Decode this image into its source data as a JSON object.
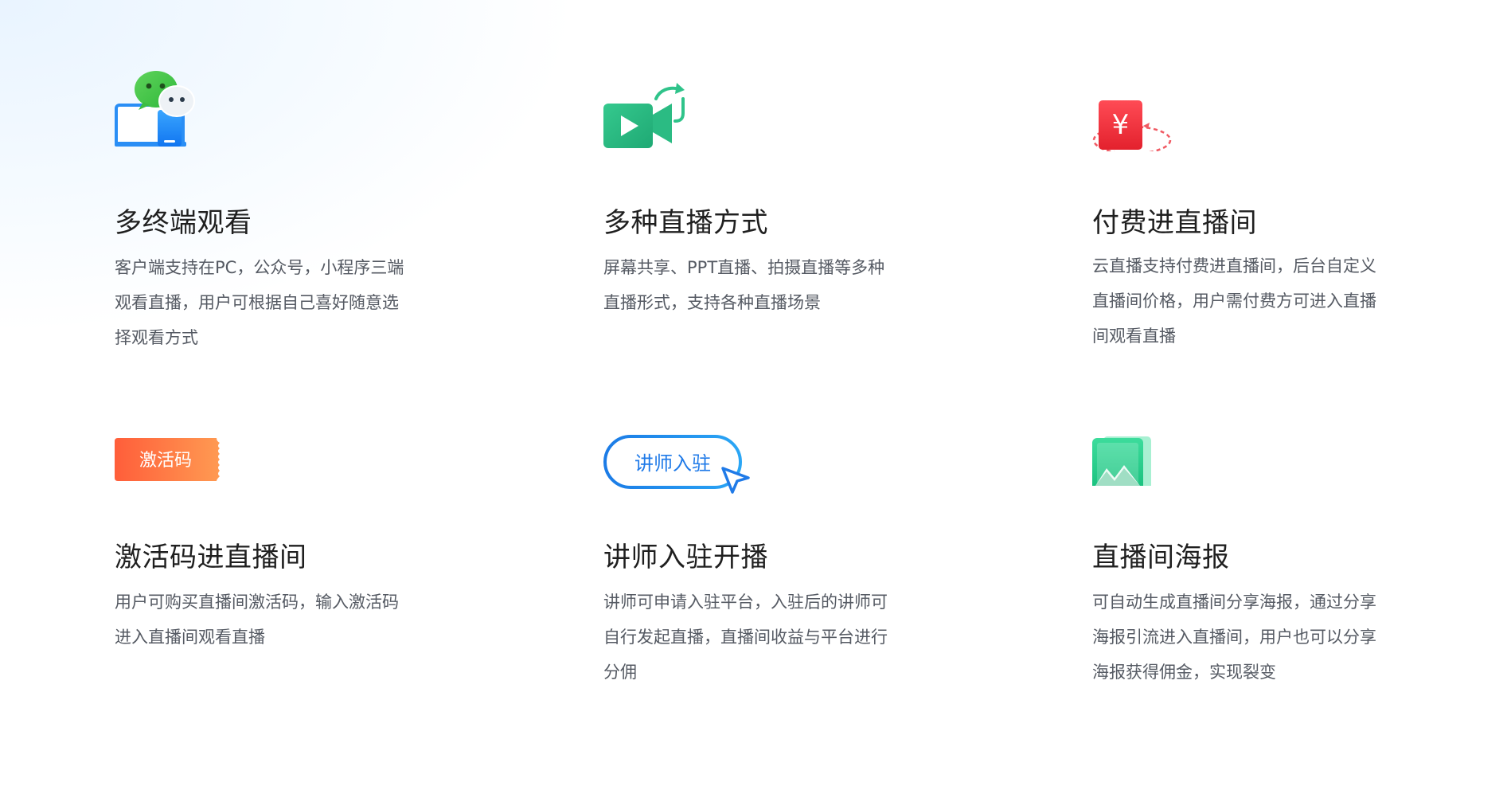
{
  "features": [
    {
      "icon": "multi-device-wechat-icon",
      "title": "多终端观看",
      "desc_lines": [
        "客户端支持在PC，公众号，小程序三端",
        "观看直播，用户可根据自己喜好随意选",
        "择观看方式"
      ]
    },
    {
      "icon": "video-camera-icon",
      "title": "多种直播方式",
      "desc_lines": [
        "屏幕共享、PPT直播、拍摄直播等多种",
        "直播形式，支持各种直播场景"
      ]
    },
    {
      "icon": "paid-yuan-icon",
      "icon_text": "¥",
      "title": "付费进直播间",
      "desc_lines": [
        "云直播支持付费进直播间，后台自定义",
        "直播间价格，用户需付费方可进入直播",
        "间观看直播"
      ]
    },
    {
      "icon": "activation-code-ticket-icon",
      "icon_text": "激活码",
      "title": "激活码进直播间",
      "desc_lines": [
        "用户可购买直播间激活码，输入激活码",
        "进入直播间观看直播"
      ]
    },
    {
      "icon": "lecturer-join-cursor-icon",
      "icon_text": "讲师入驻",
      "title": "讲师入驻开播",
      "desc_lines": [
        "讲师可申请入驻平台，入驻后的讲师可",
        "自行发起直播，直播间收益与平台进行",
        "分佣"
      ]
    },
    {
      "icon": "poster-image-icon",
      "title": "直播间海报",
      "desc_lines": [
        "可自动生成直播间分享海报，通过分享",
        "海报引流进入直播间，用户也可以分享",
        "海报获得佣金，实现裂变"
      ]
    }
  ],
  "colors": {
    "title": "#1f1f1f",
    "desc": "#555a63",
    "green": "#2fc38a",
    "red": "#f0323e",
    "orange": "#ff7a45",
    "blue": "#1f7ae8"
  }
}
